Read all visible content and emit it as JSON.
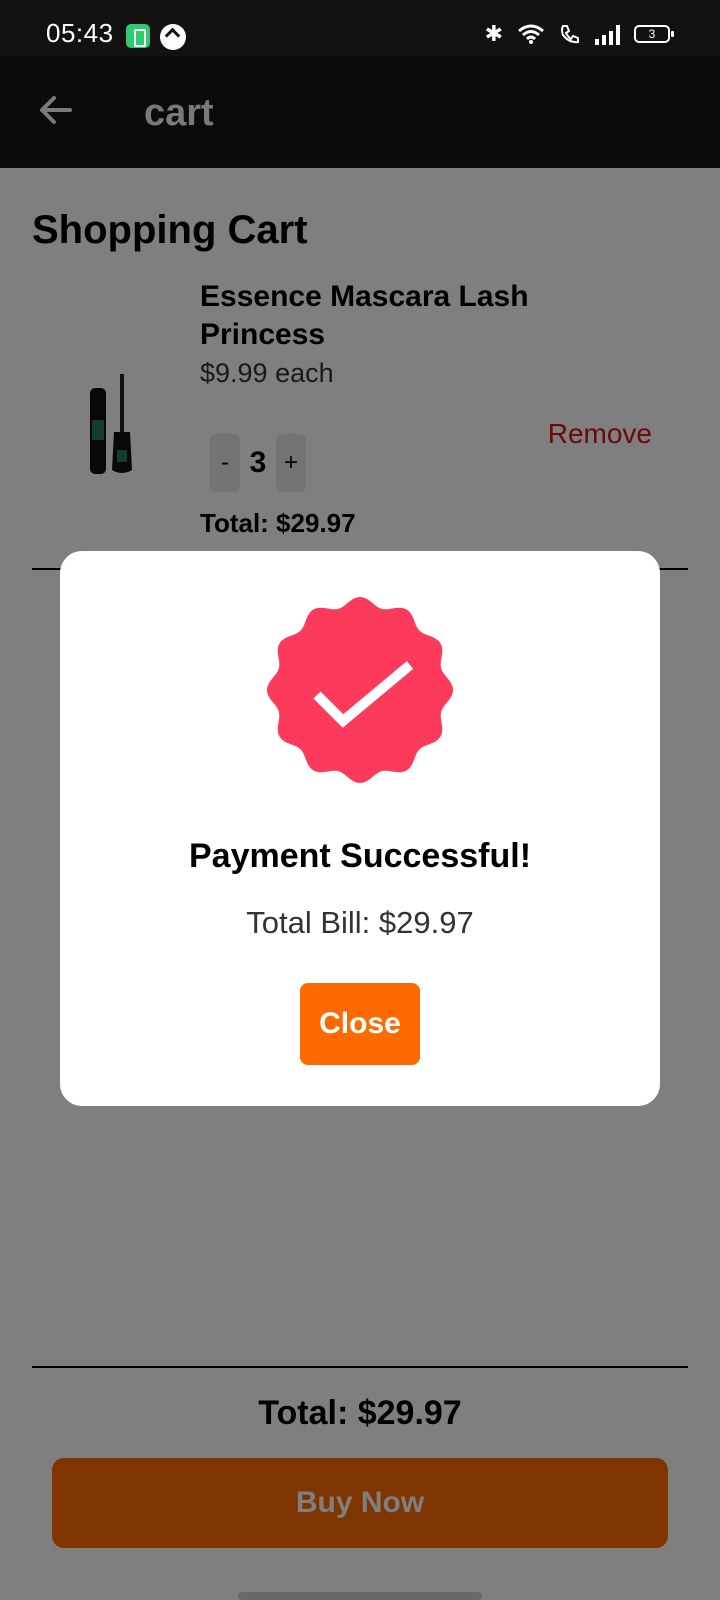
{
  "status_bar": {
    "time": "05:43",
    "battery_level": "3"
  },
  "app_bar": {
    "title": "cart"
  },
  "cart": {
    "heading": "Shopping Cart",
    "items": [
      {
        "name": "Essence Mascara Lash Princess",
        "price": "$9.99 each",
        "qty_minus": "-",
        "quantity": "3",
        "qty_plus": "+",
        "total": "Total: $29.97",
        "remove_label": "Remove"
      }
    ],
    "grand_total": "Total: $29.97",
    "buy_label": "Buy Now"
  },
  "modal": {
    "title": "Payment Successful!",
    "bill": "Total Bill: $29.97",
    "close_label": "Close"
  },
  "colors": {
    "accent": "#ff6a00",
    "success_badge": "#fb3a5c",
    "remove_red": "#d9121d"
  }
}
